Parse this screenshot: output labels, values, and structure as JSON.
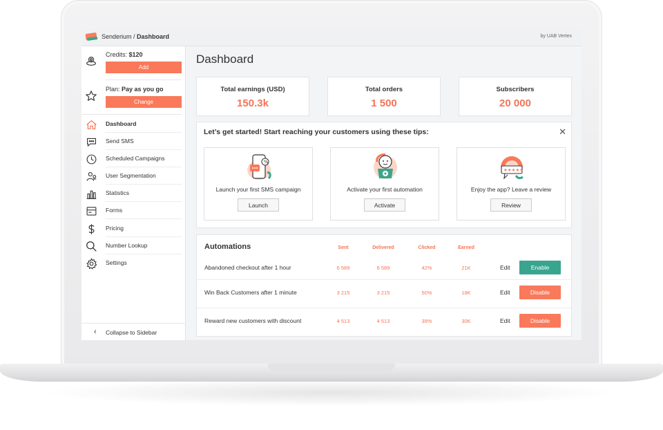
{
  "window": {
    "app": "Senderium",
    "page": "Dashboard",
    "byline": "by UAB Vertex"
  },
  "sidebar": {
    "credits_label": "Credits:",
    "credits_value": "$120",
    "add_label": "Add",
    "plan_label": "Plan:",
    "plan_value": "Pay as you go",
    "change_label": "Change",
    "items": [
      {
        "label": "Dashboard",
        "icon": "home-icon"
      },
      {
        "label": "Send SMS",
        "icon": "chat-icon"
      },
      {
        "label": "Scheduled Campaigns",
        "icon": "clock-icon"
      },
      {
        "label": "User Segmentation",
        "icon": "users-icon"
      },
      {
        "label": "Statistics",
        "icon": "bar-chart-icon"
      },
      {
        "label": "Forms",
        "icon": "form-icon"
      },
      {
        "label": "Pricing",
        "icon": "dollar-icon"
      },
      {
        "label": "Number Lookup",
        "icon": "search-icon"
      },
      {
        "label": "Settings",
        "icon": "gear-icon"
      }
    ],
    "collapse_label": "Collapse to Sidebar"
  },
  "main": {
    "title": "Dashboard",
    "stats": [
      {
        "title": "Total earnings (USD)",
        "value": "150.3k"
      },
      {
        "title": "Total orders",
        "value": "1 500"
      },
      {
        "title": "Subscribers",
        "value": "20 000"
      }
    ],
    "tips": {
      "title": "Let’s get started! Start reaching your customers using these tips:",
      "close": "✕",
      "cards": [
        {
          "text": "Launch your first SMS campaign",
          "button": "Launch"
        },
        {
          "text": "Activate your first automation",
          "button": "Activate"
        },
        {
          "text": "Enjoy the app? Leave a review",
          "button": "Review"
        }
      ]
    },
    "automations": {
      "title": "Automations",
      "columns": [
        "Sent",
        "Delivered",
        "Clicked",
        "Earned"
      ],
      "edit_label": "Edit",
      "rows": [
        {
          "name": "Abandoned checkout after 1 hour",
          "sent": "6 589",
          "delivered": "6 589",
          "clicked": "42%",
          "earned": "21K",
          "action": "Enable"
        },
        {
          "name": "Win Back Customers after 1 minute",
          "sent": "3 215",
          "delivered": "3 215",
          "clicked": "50%",
          "earned": "18K",
          "action": "Disable"
        },
        {
          "name": "Reward new customers with discount",
          "sent": "4 513",
          "delivered": "4 513",
          "clicked": "39%",
          "earned": "30K",
          "action": "Disable"
        }
      ]
    }
  },
  "colors": {
    "accent": "#f9795a",
    "enable": "#3aa58e",
    "value": "#f47457"
  }
}
